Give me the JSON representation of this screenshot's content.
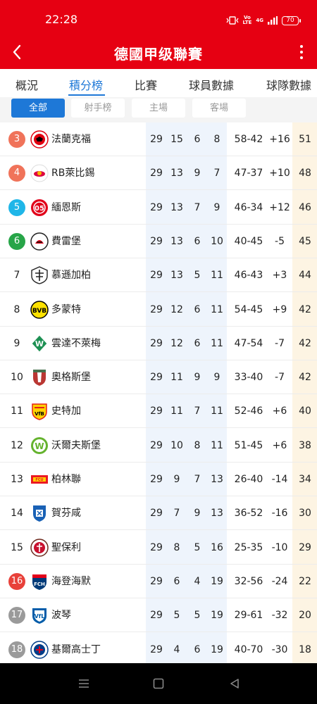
{
  "status_bar": {
    "time": "22:28",
    "volte": "Vo\nLTE",
    "network": "4G",
    "battery": "70"
  },
  "header": {
    "title": "德國甲级聯賽"
  },
  "tabs": [
    {
      "label": "概況",
      "active": false
    },
    {
      "label": "積分榜",
      "active": true
    },
    {
      "label": "比賽",
      "active": false
    },
    {
      "label": "球員數據",
      "active": false
    },
    {
      "label": "球隊數據",
      "active": false
    }
  ],
  "filters": [
    {
      "label": "全部",
      "active": true
    },
    {
      "label": "射手榜",
      "active": false
    },
    {
      "label": "主場",
      "active": false
    },
    {
      "label": "客場",
      "active": false
    }
  ],
  "colors": {
    "brand_red": "#e60012",
    "accent_blue": "#1e78d7",
    "col_highlight_blue": "#eef4fc",
    "col_highlight_orange": "#fdf4e3",
    "rank_europa": "#f0735a",
    "rank_cl": "#f2765f",
    "rank_teal": "#1fb6e8",
    "rank_conf": "#27a548",
    "rank_playoff": "#e8413a",
    "rank_relegation": "#9a9a9a"
  },
  "standings": [
    {
      "rank": "3",
      "rank_color": "#f0735a",
      "logo": "eintracht-frankfurt-logo",
      "team": "法蘭克福",
      "played": "29",
      "won": "15",
      "drawn": "6",
      "lost": "8",
      "goals": "58-42",
      "diff": "+16",
      "pts": "51"
    },
    {
      "rank": "4",
      "rank_color": "#f0735a",
      "logo": "rb-leipzig-logo",
      "team": "RB萊比錫",
      "played": "29",
      "won": "13",
      "drawn": "9",
      "lost": "7",
      "goals": "47-37",
      "diff": "+10",
      "pts": "48"
    },
    {
      "rank": "5",
      "rank_color": "#1fb6e8",
      "logo": "mainz-05-logo",
      "team": "緬恩斯",
      "played": "29",
      "won": "13",
      "drawn": "7",
      "lost": "9",
      "goals": "46-34",
      "diff": "+12",
      "pts": "46"
    },
    {
      "rank": "6",
      "rank_color": "#27a548",
      "logo": "sc-freiburg-logo",
      "team": "費雷堡",
      "played": "29",
      "won": "13",
      "drawn": "6",
      "lost": "10",
      "goals": "40-45",
      "diff": "-5",
      "pts": "45"
    },
    {
      "rank": "7",
      "rank_color": "",
      "logo": "gladbach-logo",
      "team": "慕遜加柏",
      "played": "29",
      "won": "13",
      "drawn": "5",
      "lost": "11",
      "goals": "46-43",
      "diff": "+3",
      "pts": "44"
    },
    {
      "rank": "8",
      "rank_color": "",
      "logo": "bvb-logo",
      "team": "多蒙特",
      "played": "29",
      "won": "12",
      "drawn": "6",
      "lost": "11",
      "goals": "54-45",
      "diff": "+9",
      "pts": "42"
    },
    {
      "rank": "9",
      "rank_color": "",
      "logo": "werder-bremen-logo",
      "team": "雲達不萊梅",
      "played": "29",
      "won": "12",
      "drawn": "6",
      "lost": "11",
      "goals": "47-54",
      "diff": "-7",
      "pts": "42"
    },
    {
      "rank": "10",
      "rank_color": "",
      "logo": "augsburg-logo",
      "team": "奧格斯堡",
      "played": "29",
      "won": "11",
      "drawn": "9",
      "lost": "9",
      "goals": "33-40",
      "diff": "-7",
      "pts": "42"
    },
    {
      "rank": "11",
      "rank_color": "",
      "logo": "vfb-stuttgart-logo",
      "team": "史特加",
      "played": "29",
      "won": "11",
      "drawn": "7",
      "lost": "11",
      "goals": "52-46",
      "diff": "+6",
      "pts": "40"
    },
    {
      "rank": "12",
      "rank_color": "",
      "logo": "wolfsburg-logo",
      "team": "沃爾夫斯堡",
      "played": "29",
      "won": "10",
      "drawn": "8",
      "lost": "11",
      "goals": "51-45",
      "diff": "+6",
      "pts": "38"
    },
    {
      "rank": "13",
      "rank_color": "",
      "logo": "union-berlin-logo",
      "team": "柏林聯",
      "played": "29",
      "won": "9",
      "drawn": "7",
      "lost": "13",
      "goals": "26-40",
      "diff": "-14",
      "pts": "34"
    },
    {
      "rank": "14",
      "rank_color": "",
      "logo": "hoffenheim-logo",
      "team": "賀芬咸",
      "played": "29",
      "won": "7",
      "drawn": "9",
      "lost": "13",
      "goals": "36-52",
      "diff": "-16",
      "pts": "30"
    },
    {
      "rank": "15",
      "rank_color": "",
      "logo": "st-pauli-logo",
      "team": "聖保利",
      "played": "29",
      "won": "8",
      "drawn": "5",
      "lost": "16",
      "goals": "25-35",
      "diff": "-10",
      "pts": "29"
    },
    {
      "rank": "16",
      "rank_color": "#e8413a",
      "logo": "heidenheim-logo",
      "team": "海登海默",
      "played": "29",
      "won": "6",
      "drawn": "4",
      "lost": "19",
      "goals": "32-56",
      "diff": "-24",
      "pts": "22"
    },
    {
      "rank": "17",
      "rank_color": "#9a9a9a",
      "logo": "bochum-logo",
      "team": "波琴",
      "played": "29",
      "won": "5",
      "drawn": "5",
      "lost": "19",
      "goals": "29-61",
      "diff": "-32",
      "pts": "20"
    },
    {
      "rank": "18",
      "rank_color": "#9a9a9a",
      "logo": "holstein-kiel-logo",
      "team": "基爾高士丁",
      "played": "29",
      "won": "4",
      "drawn": "6",
      "lost": "19",
      "goals": "40-70",
      "diff": "-30",
      "pts": "18"
    }
  ]
}
